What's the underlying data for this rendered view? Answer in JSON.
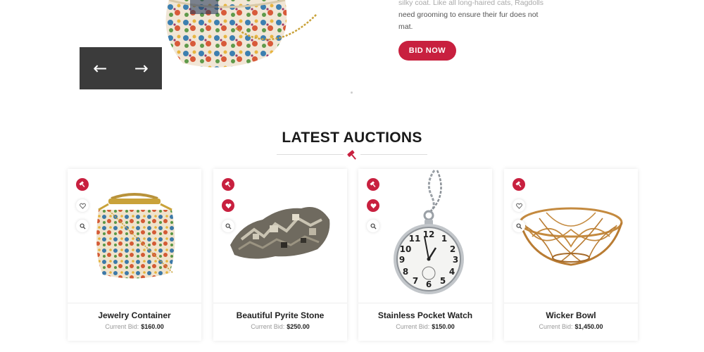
{
  "hero": {
    "description_lines": [
      "silky coat. Like all long-haired cats, Ragdolls",
      "need grooming to ensure their fur does not",
      "mat."
    ],
    "bid_button_label": "BID NOW",
    "nav": {
      "prev_icon": "←",
      "next_icon": "→"
    }
  },
  "section": {
    "title": "LATEST AUCTIONS"
  },
  "products": [
    {
      "title": "Jewelry Container",
      "bid_label": "Current Bid:",
      "bid_value": "$160.00",
      "image": "floral-purse",
      "heart_active": false
    },
    {
      "title": "Beautiful Pyrite Stone",
      "bid_label": "Current Bid:",
      "bid_value": "$250.00",
      "image": "pyrite-stone",
      "heart_active": true
    },
    {
      "title": "Stainless Pocket Watch",
      "bid_label": "Current Bid:",
      "bid_value": "$150.00",
      "image": "pocket-watch",
      "heart_active": true
    },
    {
      "title": "Wicker Bowl",
      "bid_label": "Current Bid:",
      "bid_value": "$1,450.00",
      "image": "wicker-bowl",
      "heart_active": false
    }
  ],
  "colors": {
    "accent": "#c8203f",
    "nav_bg": "#3b3b3b"
  }
}
